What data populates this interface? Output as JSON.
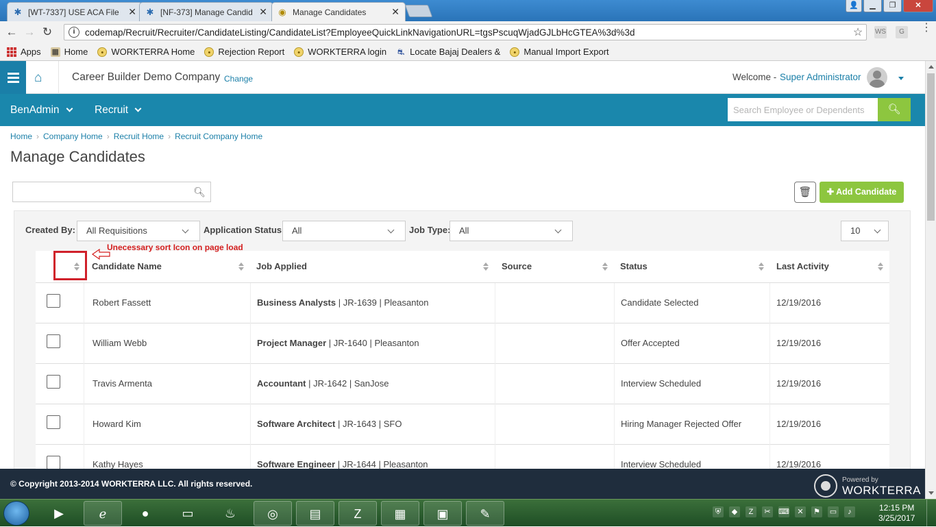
{
  "browser": {
    "tabs": [
      {
        "label": "[WT-7337] USE ACA File",
        "icon": "jira-icon"
      },
      {
        "label": "[NF-373] Manage Candid",
        "icon": "jira-icon"
      },
      {
        "label": "Manage Candidates",
        "icon": "workterra-icon"
      }
    ],
    "url": "codemap/Recruit/Recruiter/CandidateListing/CandidateList?EmployeeQuickLinkNavigationURL=tgsPscuqWjadGJLbHcGTEA%3d%3d",
    "bookmarks": [
      {
        "label": "Apps",
        "icon": "apps-icon"
      },
      {
        "label": "Home",
        "icon": "home-page-icon"
      },
      {
        "label": "WORKTERRA Home",
        "icon": "workterra-icon"
      },
      {
        "label": "Rejection Report",
        "icon": "workterra-icon"
      },
      {
        "label": "WORKTERRA login",
        "icon": "workterra-icon"
      },
      {
        "label": "Locate Bajaj Dealers &",
        "icon": "bajaj-icon"
      },
      {
        "label": "Manual Import Export",
        "icon": "workterra-icon"
      }
    ],
    "extensions": [
      "WS",
      "G"
    ]
  },
  "header": {
    "company": "Career Builder Demo Company",
    "change_label": "Change",
    "welcome": "Welcome -",
    "user": "Super Administrator"
  },
  "nav": {
    "items": [
      "BenAdmin",
      "Recruit"
    ],
    "search_placeholder": "Search Employee or Dependents"
  },
  "breadcrumb": [
    "Home",
    "Company Home",
    "Recruit Home",
    "Recruit Company Home"
  ],
  "page": {
    "title": "Manage Candidates",
    "add_button": "Add Candidate"
  },
  "filters": {
    "created_by_label": "Created By:",
    "created_by_value": "All Requisitions",
    "status_label": "Application Status:",
    "status_value": "All",
    "jobtype_label": "Job Type:",
    "jobtype_value": "All",
    "page_size": "10"
  },
  "annotation": "Unecessary sort Icon on page load",
  "table": {
    "headers": [
      "Candidate Name",
      "Job Applied",
      "Source",
      "Status",
      "Last Activity"
    ],
    "rows": [
      {
        "name": "Robert Fassett",
        "job_title": "Business Analysts",
        "job_rest": " | JR-1639 | Pleasanton",
        "source": "",
        "status": "Candidate Selected",
        "last": "12/19/2016"
      },
      {
        "name": "William Webb",
        "job_title": "Project Manager",
        "job_rest": " | JR-1640 | Pleasanton",
        "source": "",
        "status": "Offer Accepted",
        "last": "12/19/2016"
      },
      {
        "name": "Travis Armenta",
        "job_title": "Accountant",
        "job_rest": " | JR-1642 | SanJose",
        "source": "",
        "status": "Interview Scheduled",
        "last": "12/19/2016"
      },
      {
        "name": "Howard Kim",
        "job_title": "Software Architect",
        "job_rest": " | JR-1643 | SFO",
        "source": "",
        "status": "Hiring Manager Rejected Offer",
        "last": "12/19/2016"
      },
      {
        "name": "Kathy Hayes",
        "job_title": "Software Engineer",
        "job_rest": " | JR-1644 | Pleasanton",
        "source": "",
        "status": "Interview Scheduled",
        "last": "12/19/2016"
      }
    ]
  },
  "footer": {
    "copyright": "© Copyright 2013-2014 WORKTERRA LLC. All rights reserved.",
    "powered": "Powered by",
    "brand": "WORKTERRA"
  },
  "taskbar": {
    "time": "12:15 PM",
    "date": "3/25/2017"
  },
  "colors": {
    "teal": "#1a87ac",
    "green": "#8dc63f",
    "annotation_red": "#d31e1e",
    "footer": "#1f2d3d"
  }
}
